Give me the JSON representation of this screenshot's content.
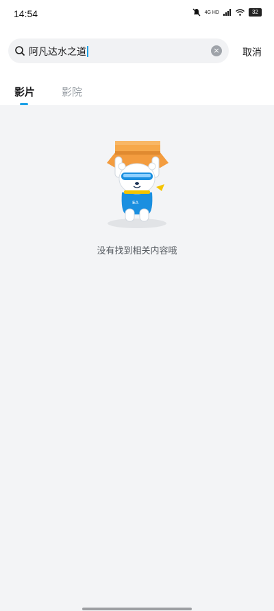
{
  "status_bar": {
    "time": "14:54",
    "network": "4G HD",
    "battery": "32"
  },
  "search": {
    "query": "阿凡达水之道",
    "cancel_label": "取消"
  },
  "tabs": [
    {
      "label": "影片",
      "active": true
    },
    {
      "label": "影院",
      "active": false
    }
  ],
  "empty_state": {
    "message": "没有找到相关内容哦"
  },
  "colors": {
    "accent": "#1aa0e6",
    "background": "#f3f4f6"
  }
}
